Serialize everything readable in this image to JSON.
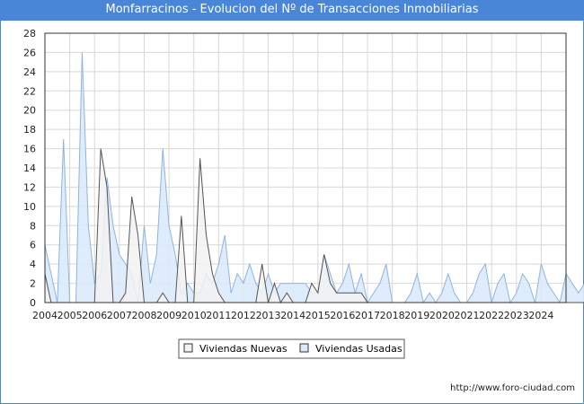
{
  "header": {
    "title": "Monfarracinos - Evolucion del Nº de Transacciones Inmobiliarias"
  },
  "footer": {
    "credit": "http://www.foro-ciudad.com"
  },
  "colors": {
    "title_bg": "#4a86d8",
    "nuevas_fill": "#f2f2f2",
    "nuevas_line": "#555555",
    "usadas_fill": "#dbeafb",
    "usadas_line": "#8db5e0",
    "grid": "#d8d8d8"
  },
  "chart_data": {
    "type": "area",
    "title": "",
    "xlabel": "",
    "ylabel": "",
    "ylim": [
      0,
      28
    ],
    "yticks": [
      "0",
      "2",
      "4",
      "6",
      "8",
      "10",
      "12",
      "14",
      "16",
      "18",
      "20",
      "22",
      "24",
      "26",
      "28"
    ],
    "year_labels": [
      "2004",
      "2005",
      "2006",
      "2007",
      "2008",
      "2009",
      "2010",
      "2011",
      "2012",
      "2013",
      "2014",
      "2015",
      "2016",
      "2017",
      "2018",
      "2019",
      "2020",
      "2021",
      "2022",
      "2023",
      "2024"
    ],
    "x_start": 2004.0,
    "x_step": 0.25,
    "grid": true,
    "legend_position": "bottom-center",
    "series": [
      {
        "name": "Viviendas Nuevas",
        "values": [
          3,
          0,
          0,
          0,
          0,
          0,
          0,
          0,
          0,
          16,
          12,
          0,
          0,
          1,
          11,
          7,
          0,
          0,
          0,
          1,
          0,
          0,
          9,
          0,
          0,
          15,
          7,
          3,
          1,
          0,
          0,
          0,
          0,
          0,
          0,
          4,
          0,
          2,
          0,
          1,
          0,
          0,
          0,
          2,
          1,
          5,
          2,
          1,
          1,
          1,
          1,
          1,
          0,
          0,
          0,
          0,
          0,
          0,
          0,
          0,
          0,
          0,
          0,
          0,
          0,
          0,
          0,
          0,
          0,
          0,
          0,
          0,
          0,
          0,
          0,
          0,
          0,
          0,
          0,
          0,
          0,
          0,
          0,
          0,
          0,
          0,
          0,
          0,
          0,
          0,
          0,
          0,
          0,
          0,
          0,
          0,
          0,
          0,
          0,
          0,
          0,
          0,
          0,
          0,
          0,
          0,
          0,
          0,
          0,
          0,
          1,
          0,
          0,
          0,
          0,
          0,
          0,
          0,
          0,
          0,
          0,
          0,
          0,
          0,
          0,
          0,
          0,
          0,
          0,
          0,
          0,
          0,
          0,
          0
        ]
      },
      {
        "name": "Viviendas Usadas",
        "values": [
          6,
          3,
          0,
          17,
          0,
          0,
          26,
          8,
          2,
          3,
          13,
          8,
          5,
          4,
          3,
          0,
          8,
          2,
          5,
          16,
          8,
          5,
          1,
          2,
          1,
          1,
          3,
          2,
          4,
          7,
          1,
          3,
          2,
          4,
          2,
          1,
          3,
          1,
          2,
          2,
          2,
          2,
          2,
          1,
          1,
          5,
          3,
          1,
          2,
          4,
          1,
          3,
          0,
          1,
          2,
          4,
          0,
          0,
          0,
          1,
          3,
          0,
          1,
          0,
          1,
          3,
          1,
          0,
          0,
          1,
          3,
          4,
          0,
          2,
          3,
          0,
          1,
          3,
          2,
          0,
          4,
          2,
          1,
          0,
          3,
          2,
          1,
          2,
          3,
          1,
          2,
          1,
          0,
          0,
          1,
          6,
          2,
          1,
          2,
          1,
          2,
          3,
          2,
          3,
          4,
          1,
          4,
          2,
          3
        ]
      }
    ]
  },
  "legend": {
    "items": [
      {
        "label": "Viviendas Nuevas"
      },
      {
        "label": "Viviendas Usadas"
      }
    ]
  }
}
